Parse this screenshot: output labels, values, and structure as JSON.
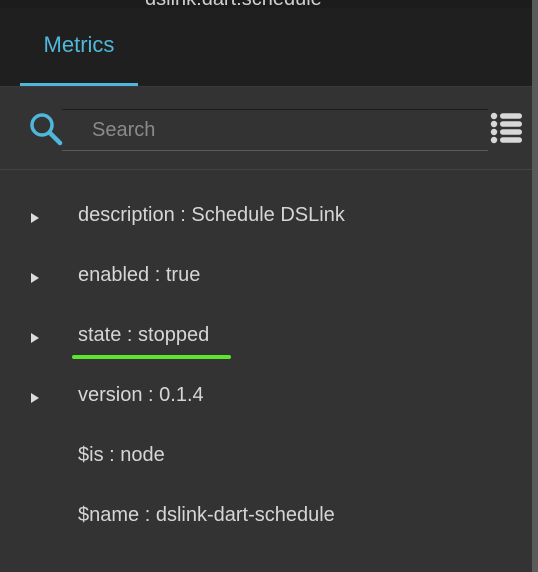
{
  "top_strip": {
    "text": "dslink:dart:schedule"
  },
  "tabs": [
    {
      "label": "Metrics",
      "active": true
    }
  ],
  "search": {
    "placeholder": "Search",
    "value": ""
  },
  "properties": [
    {
      "key": "description",
      "value": "Schedule DSLink",
      "text": "description : Schedule DSLink",
      "expandable": true,
      "highlighted": false
    },
    {
      "key": "enabled",
      "value": "true",
      "text": "enabled : true",
      "expandable": true,
      "highlighted": false
    },
    {
      "key": "state",
      "value": "stopped",
      "text": "state : stopped",
      "expandable": true,
      "highlighted": true
    },
    {
      "key": "version",
      "value": "0.1.4",
      "text": "version : 0.1.4",
      "expandable": true,
      "highlighted": false
    },
    {
      "key": "$is",
      "value": "node",
      "text": "$is : node",
      "expandable": false,
      "highlighted": false
    },
    {
      "key": "$name",
      "value": "dslink-dart-schedule",
      "text": "$name : dslink-dart-schedule",
      "expandable": false,
      "highlighted": false
    }
  ],
  "colors": {
    "accent": "#4fb7d9",
    "highlight": "#5ce52f",
    "background": "#333333",
    "tab_bar": "#1f1f1f"
  },
  "icons": {
    "search": "search-icon",
    "list": "list-icon",
    "caret": "caret-right-icon"
  }
}
